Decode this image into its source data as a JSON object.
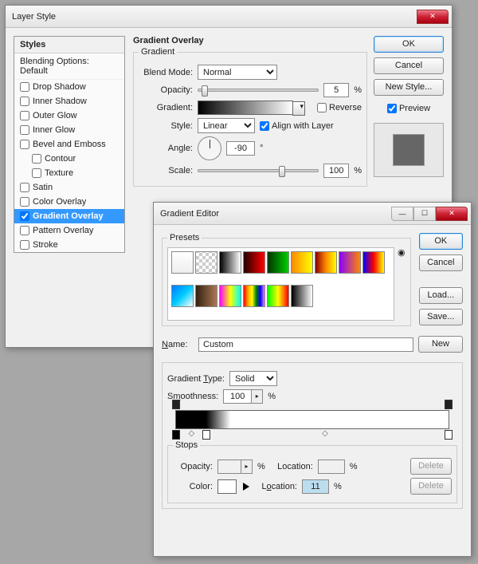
{
  "layerStyle": {
    "title": "Layer Style",
    "stylesHeader": "Styles",
    "blendingOptions": "Blending Options: Default",
    "items": [
      {
        "label": "Drop Shadow",
        "checked": false
      },
      {
        "label": "Inner Shadow",
        "checked": false
      },
      {
        "label": "Outer Glow",
        "checked": false
      },
      {
        "label": "Inner Glow",
        "checked": false
      },
      {
        "label": "Bevel and Emboss",
        "checked": false
      },
      {
        "label": "Contour",
        "checked": false,
        "indent": true
      },
      {
        "label": "Texture",
        "checked": false,
        "indent": true
      },
      {
        "label": "Satin",
        "checked": false
      },
      {
        "label": "Color Overlay",
        "checked": false
      },
      {
        "label": "Gradient Overlay",
        "checked": true,
        "active": true
      },
      {
        "label": "Pattern Overlay",
        "checked": false
      },
      {
        "label": "Stroke",
        "checked": false
      }
    ],
    "sectionTitle": "Gradient Overlay",
    "subTitle": "Gradient",
    "labels": {
      "blendMode": "Blend Mode:",
      "opacity": "Opacity:",
      "gradient": "Gradient:",
      "reverse": "Reverse",
      "style": "Style:",
      "align": "Align with Layer",
      "angle": "Angle:",
      "scale": "Scale:"
    },
    "values": {
      "blendMode": "Normal",
      "opacity": "5",
      "style": "Linear",
      "alignChecked": true,
      "reverseChecked": false,
      "angle": "-90",
      "scale": "100"
    },
    "buttons": {
      "ok": "OK",
      "cancel": "Cancel",
      "newStyle": "New Style...",
      "preview": "Preview"
    }
  },
  "gradientEditor": {
    "title": "Gradient Editor",
    "presetsLabel": "Presets",
    "presets": [
      "linear-gradient(#fff,#eee)",
      "repeating-conic-gradient(#ccc 0 25%,#fff 0 50%) 0/8px 8px",
      "linear-gradient(90deg,#000,#fff)",
      "linear-gradient(90deg,#200,#f00)",
      "linear-gradient(90deg,#030,#0c0)",
      "linear-gradient(90deg,#f80,#ff0)",
      "linear-gradient(90deg,#800,#f80,#ff0)",
      "linear-gradient(90deg,#80f,#f80)",
      "linear-gradient(90deg,#00f,#f00,#ff0)",
      "linear-gradient(135deg,#07f,#0cf,#fff)",
      "linear-gradient(90deg,#321,#a75)",
      "linear-gradient(90deg,#f0f,#ff0,#0ff)",
      "linear-gradient(90deg,red,orange,yellow,green,blue,violet)",
      "linear-gradient(90deg,#0f0,#ff0,#f00)",
      "linear-gradient(90deg,#000,rgba(0,0,0,0))"
    ],
    "labels": {
      "name": "Name:",
      "gradientType": "Gradient Type:",
      "smoothness": "Smoothness:",
      "stops": "Stops",
      "opacity": "Opacity:",
      "location": "Location:",
      "color": "Color:",
      "pct": "%"
    },
    "values": {
      "name": "Custom",
      "gradientType": "Solid",
      "smoothness": "100",
      "locationBottom": "11"
    },
    "buttons": {
      "ok": "OK",
      "cancel": "Cancel",
      "load": "Load...",
      "save": "Save...",
      "new": "New",
      "delete": "Delete"
    }
  }
}
